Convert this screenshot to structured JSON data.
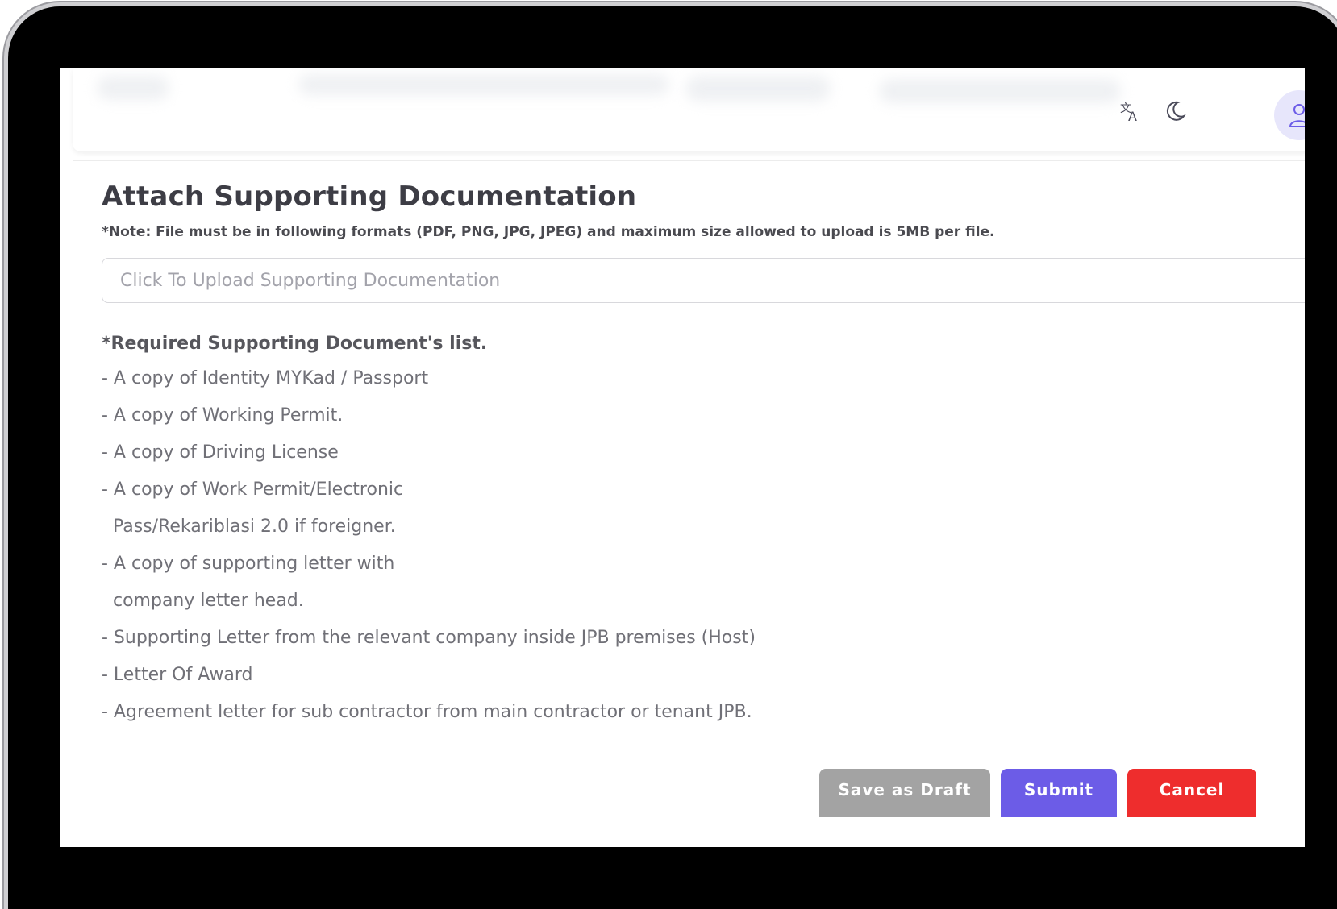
{
  "header": {
    "translate_icon": "translate-icon",
    "theme_icon": "moon-icon",
    "avatar_icon": "user-icon",
    "status_color": "#28c76f"
  },
  "section": {
    "title": "Attach Supporting Documentation",
    "note": "*Note: File must be in following formats (PDF, PNG, JPG, JPEG) and maximum size allowed to upload is 5MB per file.",
    "upload_placeholder": "Click To Upload Supporting Documentation"
  },
  "requirements": {
    "title": "*Required Supporting Document's list.",
    "items": [
      "- A copy of Identity MYKad / Passport",
      "- A copy of Working Permit.",
      "- A copy of Driving License",
      "- A copy of Work Permit/Electronic",
      "  Pass/Rekariblasi 2.0 if foreigner.",
      "- A copy of supporting letter with",
      "  company letter head.",
      "- Supporting Letter from the relevant company inside JPB premises (Host)",
      "- Letter Of Award",
      "- Agreement letter for sub contractor from main contractor or tenant JPB."
    ]
  },
  "actions": {
    "save_draft": "Save as Draft",
    "submit": "Submit",
    "cancel": "Cancel",
    "colors": {
      "save_draft": "#a3a3a3",
      "submit": "#6c5ce7",
      "cancel": "#ee2d2d"
    }
  }
}
